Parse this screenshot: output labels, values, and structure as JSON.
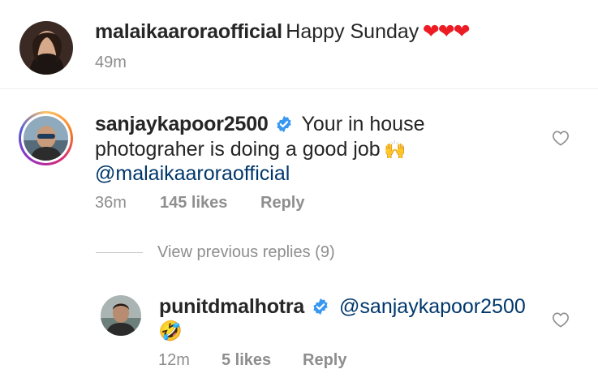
{
  "caption": {
    "username": "malaikaaroraofficial",
    "text": "Happy Sunday",
    "emoji": "❤❤❤",
    "time": "49m"
  },
  "comment": {
    "username": "sanjaykapoor2500",
    "line1": "Your in house",
    "line2": "photograher is doing a good job",
    "emoji": "🙌",
    "mention": "@malaikaaroraofficial",
    "time": "36m",
    "likes": "145 likes",
    "reply_label": "Reply"
  },
  "view_previous_replies": "View previous replies (9)",
  "reply": {
    "username": "punitdmalhotra",
    "mention": "@sanjaykapoor2500",
    "emoji": "🤣",
    "time": "12m",
    "likes": "5 likes",
    "reply_label": "Reply"
  },
  "colors": {
    "text": "#262626",
    "secondary": "#8e8e8e",
    "link": "#00376b",
    "verified": "#3897f0",
    "heart": "#ed1c24"
  }
}
